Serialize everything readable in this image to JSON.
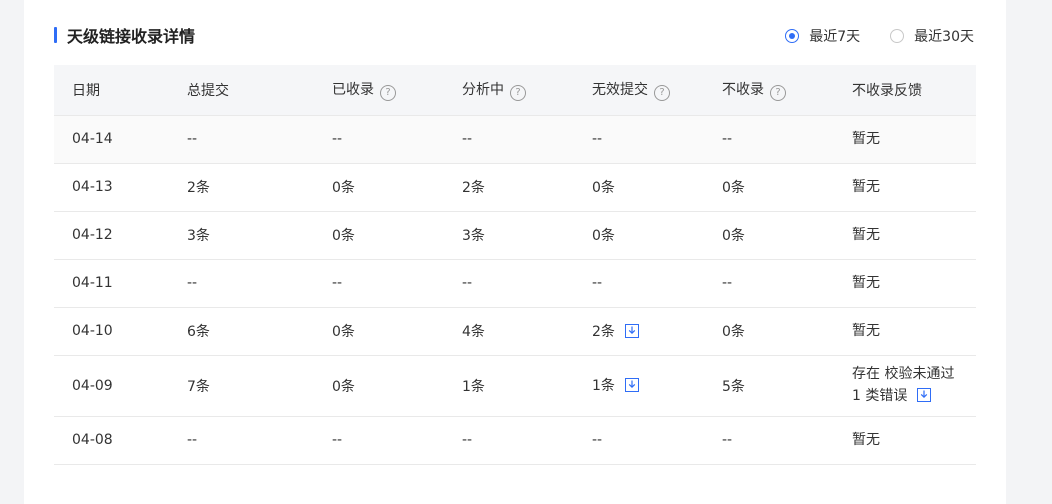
{
  "section": {
    "title": "天级链接收录详情"
  },
  "range": {
    "options": [
      "最近7天",
      "最近30天"
    ],
    "selected": 0
  },
  "colors": {
    "accent": "#2f6df6"
  },
  "table": {
    "headers": [
      "日期",
      "总提交",
      "已收录",
      "分析中",
      "无效提交",
      "不收录",
      "不收录反馈"
    ],
    "header_help": [
      false,
      false,
      true,
      true,
      true,
      true,
      false
    ],
    "rows": [
      {
        "date": "04-14",
        "total": "--",
        "indexed": "--",
        "analyzing": "--",
        "invalid": "--",
        "invalid_dl": false,
        "not_indexed": "--",
        "feedback": [
          "暂无"
        ],
        "feedback_dl": false
      },
      {
        "date": "04-13",
        "total": "2条",
        "indexed": "0条",
        "analyzing": "2条",
        "invalid": "0条",
        "invalid_dl": false,
        "not_indexed": "0条",
        "feedback": [
          "暂无"
        ],
        "feedback_dl": false
      },
      {
        "date": "04-12",
        "total": "3条",
        "indexed": "0条",
        "analyzing": "3条",
        "invalid": "0条",
        "invalid_dl": false,
        "not_indexed": "0条",
        "feedback": [
          "暂无"
        ],
        "feedback_dl": false
      },
      {
        "date": "04-11",
        "total": "--",
        "indexed": "--",
        "analyzing": "--",
        "invalid": "--",
        "invalid_dl": false,
        "not_indexed": "--",
        "feedback": [
          "暂无"
        ],
        "feedback_dl": false
      },
      {
        "date": "04-10",
        "total": "6条",
        "indexed": "0条",
        "analyzing": "4条",
        "invalid": "2条",
        "invalid_dl": true,
        "not_indexed": "0条",
        "feedback": [
          "暂无"
        ],
        "feedback_dl": false
      },
      {
        "date": "04-09",
        "total": "7条",
        "indexed": "0条",
        "analyzing": "1条",
        "invalid": "1条",
        "invalid_dl": true,
        "not_indexed": "5条",
        "feedback": [
          "存在 校验未通过",
          "1 类错误"
        ],
        "feedback_dl": true
      },
      {
        "date": "04-08",
        "total": "--",
        "indexed": "--",
        "analyzing": "--",
        "invalid": "--",
        "invalid_dl": false,
        "not_indexed": "--",
        "feedback": [
          "暂无"
        ],
        "feedback_dl": false
      }
    ]
  }
}
